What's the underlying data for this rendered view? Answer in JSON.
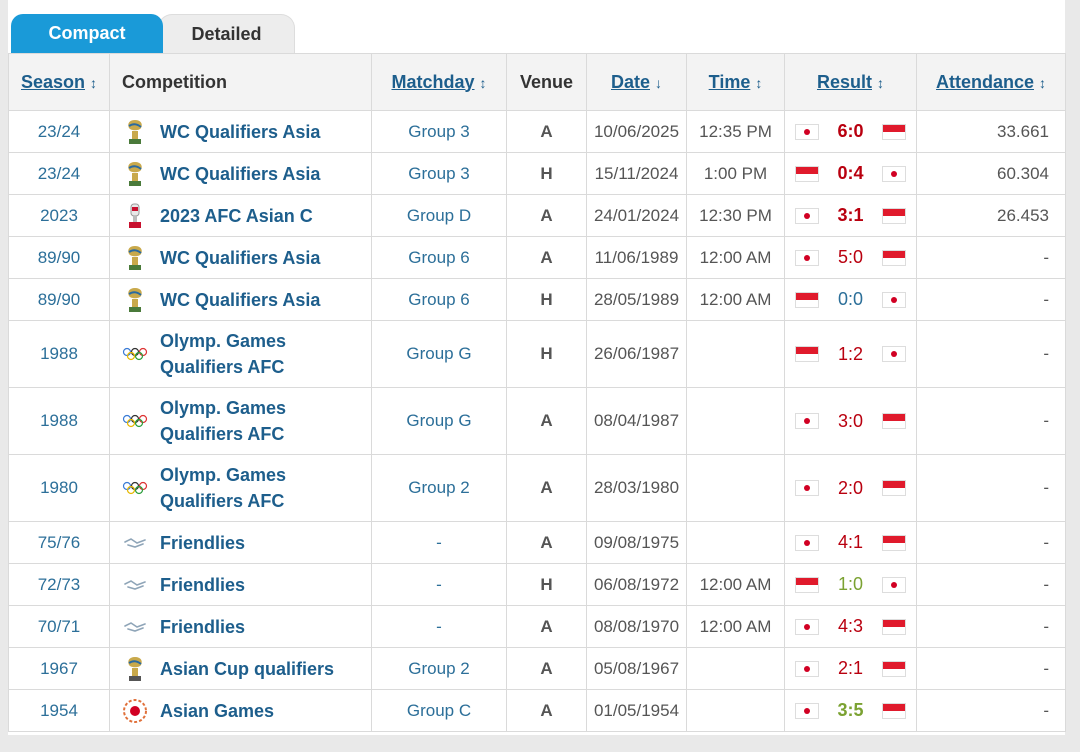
{
  "tabs": {
    "compact": "Compact",
    "detailed": "Detailed"
  },
  "headers": {
    "season": "Season",
    "competition": "Competition",
    "matchday": "Matchday",
    "venue": "Venue",
    "date": "Date",
    "time": "Time",
    "result": "Result",
    "attendance": "Attendance"
  },
  "colors": {
    "accent": "#1a9ad8",
    "link": "#1d5e8c",
    "loss": "#b9000f",
    "draw": "#2c6f99",
    "win": "#7ba232"
  },
  "rows": [
    {
      "season": "23/24",
      "icon": "world-cup-trophy-icon",
      "competition": "WC Qualifiers Asia",
      "matchday": "Group 3",
      "venue": "A",
      "date": "10/06/2025",
      "time": "12:35 PM",
      "home_flag": "jp",
      "score": "6:0",
      "away_flag": "id",
      "att": "33.661"
    },
    {
      "season": "23/24",
      "icon": "world-cup-trophy-icon",
      "competition": "WC Qualifiers Asia",
      "matchday": "Group 3",
      "venue": "H",
      "date": "15/11/2024",
      "time": "1:00 PM",
      "home_flag": "id",
      "score": "0:4",
      "away_flag": "jp",
      "att": "60.304"
    },
    {
      "season": "2023",
      "icon": "asian-cup-trophy-icon",
      "competition": "2023 AFC Asian C",
      "matchday": "Group D",
      "venue": "A",
      "date": "24/01/2024",
      "time": "12:30 PM",
      "home_flag": "jp",
      "score": "3:1",
      "away_flag": "id",
      "att": "26.453"
    },
    {
      "season": "89/90",
      "icon": "world-cup-trophy-icon",
      "competition": "WC Qualifiers Asia",
      "matchday": "Group 6",
      "venue": "A",
      "date": "11/06/1989",
      "time": "12:00 AM",
      "home_flag": "jp",
      "score": "5:0",
      "away_flag": "id",
      "att": "-"
    },
    {
      "season": "89/90",
      "icon": "world-cup-trophy-icon",
      "competition": "WC Qualifiers Asia",
      "matchday": "Group 6",
      "venue": "H",
      "date": "28/05/1989",
      "time": "12:00 AM",
      "home_flag": "id",
      "score": "0:0",
      "away_flag": "jp",
      "att": "-"
    },
    {
      "season": "1988",
      "icon": "olympic-rings-icon",
      "competition": "Olymp. Games Qualifiers AFC",
      "matchday": "Group G",
      "venue": "H",
      "date": "26/06/1987",
      "time": "",
      "home_flag": "id",
      "score": "1:2",
      "away_flag": "jp",
      "att": "-"
    },
    {
      "season": "1988",
      "icon": "olympic-rings-icon",
      "competition": "Olymp. Games Qualifiers AFC",
      "matchday": "Group G",
      "venue": "A",
      "date": "08/04/1987",
      "time": "",
      "home_flag": "jp",
      "score": "3:0",
      "away_flag": "id",
      "att": "-"
    },
    {
      "season": "1980",
      "icon": "olympic-rings-icon",
      "competition": "Olymp. Games Qualifiers AFC",
      "matchday": "Group 2",
      "venue": "A",
      "date": "28/03/1980",
      "time": "",
      "home_flag": "jp",
      "score": "2:0",
      "away_flag": "id",
      "att": "-"
    },
    {
      "season": "75/76",
      "icon": "friendlies-handshake-icon",
      "competition": "Friendlies",
      "matchday": "-",
      "venue": "A",
      "date": "09/08/1975",
      "time": "",
      "home_flag": "jp",
      "score": "4:1",
      "away_flag": "id",
      "att": "-"
    },
    {
      "season": "72/73",
      "icon": "friendlies-handshake-icon",
      "competition": "Friendlies",
      "matchday": "-",
      "venue": "H",
      "date": "06/08/1972",
      "time": "12:00 AM",
      "home_flag": "id",
      "score": "1:0",
      "away_flag": "jp",
      "att": "-"
    },
    {
      "season": "70/71",
      "icon": "friendlies-handshake-icon",
      "competition": "Friendlies",
      "matchday": "-",
      "venue": "A",
      "date": "08/08/1970",
      "time": "12:00 AM",
      "home_flag": "jp",
      "score": "4:3",
      "away_flag": "id",
      "att": "-"
    },
    {
      "season": "1967",
      "icon": "asian-cup-qualifiers-trophy-icon",
      "competition": "Asian Cup qualifiers",
      "matchday": "Group 2",
      "venue": "A",
      "date": "05/08/1967",
      "time": "",
      "home_flag": "jp",
      "score": "2:1",
      "away_flag": "id",
      "att": "-"
    },
    {
      "season": "1954",
      "icon": "asian-games-emblem-icon",
      "competition": "Asian Games",
      "matchday": "Group C",
      "venue": "A",
      "date": "01/05/1954",
      "time": "",
      "home_flag": "jp",
      "score": "3:5",
      "away_flag": "id",
      "att": "-"
    }
  ]
}
